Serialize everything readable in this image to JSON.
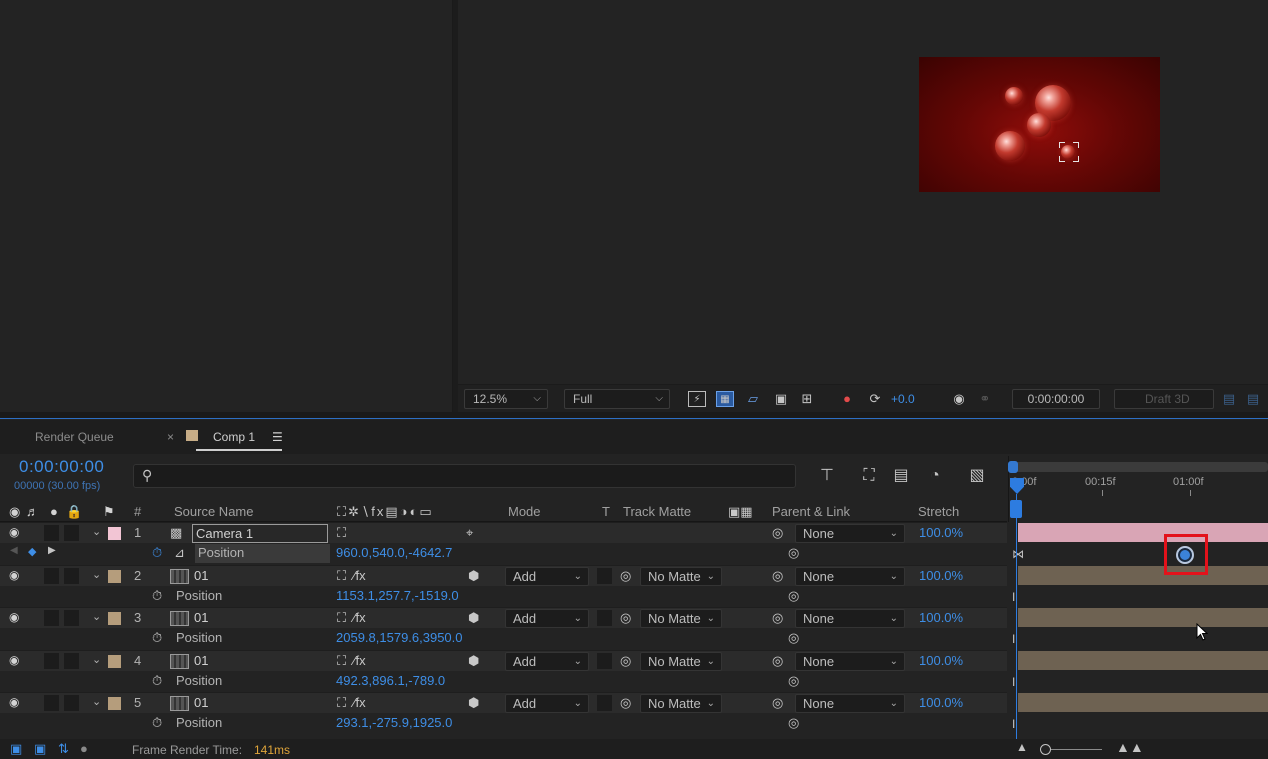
{
  "tabs": {
    "render_queue": "Render Queue",
    "comp": "Comp 1"
  },
  "viewer": {
    "zoom": "12.5%",
    "resolution": "Full",
    "exposure": "+0.0",
    "timecode": "0:00:00:00",
    "renderer": "Draft 3D"
  },
  "timeline": {
    "current_time": "0:00:00:00",
    "fps": "00000 (30.00 fps)",
    "search_placeholder": ""
  },
  "columns": {
    "number": "#",
    "source_name": "Source Name",
    "mode": "Mode",
    "t": "T",
    "track_matte": "Track Matte",
    "parent_link": "Parent & Link",
    "stretch": "Stretch"
  },
  "layers": [
    {
      "num": "1",
      "name": "Camera 1",
      "color": "#f2c5d4",
      "mode": "",
      "matte": "",
      "parent": "None",
      "stretch": "100.0%",
      "prop": "Position",
      "value": "960.0,540.0,-4642.7"
    },
    {
      "num": "2",
      "name": "01",
      "color": "#b59d7c",
      "mode": "Add",
      "matte": "No Matte",
      "parent": "None",
      "stretch": "100.0%",
      "prop": "Position",
      "value": "1153.1,257.7,-1519.0"
    },
    {
      "num": "3",
      "name": "01",
      "color": "#b59d7c",
      "mode": "Add",
      "matte": "No Matte",
      "parent": "None",
      "stretch": "100.0%",
      "prop": "Position",
      "value": "2059.8,1579.6,3950.0"
    },
    {
      "num": "4",
      "name": "01",
      "color": "#b59d7c",
      "mode": "Add",
      "matte": "No Matte",
      "parent": "None",
      "stretch": "100.0%",
      "prop": "Position",
      "value": "492.3,896.1,-789.0"
    },
    {
      "num": "5",
      "name": "01",
      "color": "#b59d7c",
      "mode": "Add",
      "matte": "No Matte",
      "parent": "None",
      "stretch": "100.0%",
      "prop": "Position",
      "value": "293.1,-275.9,1925.0"
    }
  ],
  "ruler": {
    "t0": "0:00f",
    "t1": "00:15f",
    "t2": "01:00f"
  },
  "status": {
    "label": "Frame Render Time:",
    "value": "141ms"
  },
  "icons": [
    "eye-icon",
    "audio-icon",
    "solo-icon",
    "lock-icon",
    "label-icon",
    "stopwatch-icon",
    "graph-icon",
    "camera-icon",
    "search-icon",
    "keyframe-icon"
  ]
}
